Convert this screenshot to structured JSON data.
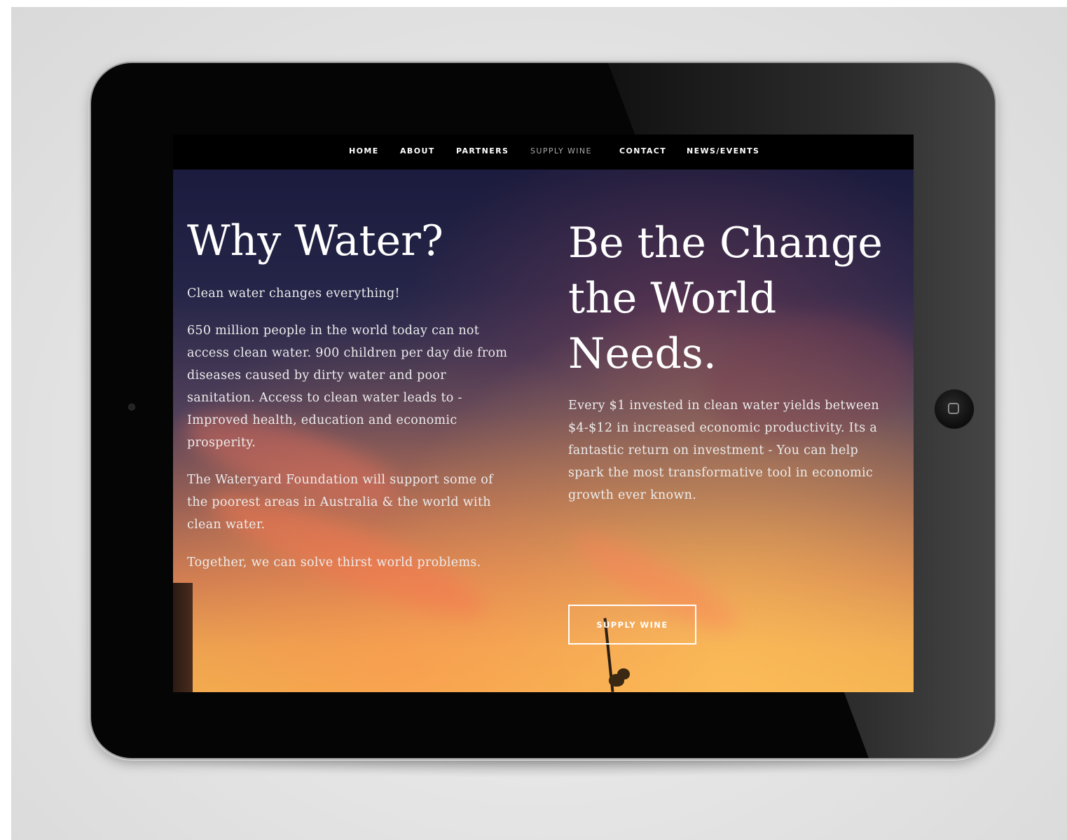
{
  "nav": {
    "items": [
      {
        "label": "HOME"
      },
      {
        "label": "ABOUT"
      },
      {
        "label": "PARTNERS"
      },
      {
        "label": "SUPPLY WINE",
        "active": true
      },
      {
        "label": "CONTACT"
      },
      {
        "label": "NEWS/EVENTS"
      }
    ]
  },
  "left": {
    "heading": "Why Water?",
    "tagline": "Clean water changes everything!",
    "paragraph1_lines": [
      "650 million people in the world today can not",
      "access clean water. 900 children per day die from",
      "diseases caused by dirty water and poor",
      "sanitation. Access to clean water leads to -",
      "Improved health, education and economic",
      "prosperity."
    ],
    "paragraph2_lines": [
      "The Wateryard Foundation will support some of",
      "the poorest areas in Australia & the world with",
      "clean water."
    ],
    "paragraph3": "Together, we can solve thirst world problems."
  },
  "right": {
    "heading_lines": [
      "Be the Change",
      "the World",
      "Needs."
    ],
    "paragraph_lines": [
      "Every $1 invested in clean water yields between",
      "$4-$12 in increased economic productivity. Its a",
      "fantastic return on investment - You can help",
      "spark the most transformative tool in economic",
      "growth ever known."
    ],
    "button_label": "SUPPLY WINE"
  },
  "colors": {
    "nav_background": "#000000",
    "nav_active": "#a9a9a9",
    "text": "#ffffff",
    "device_bezel": "#050505"
  }
}
